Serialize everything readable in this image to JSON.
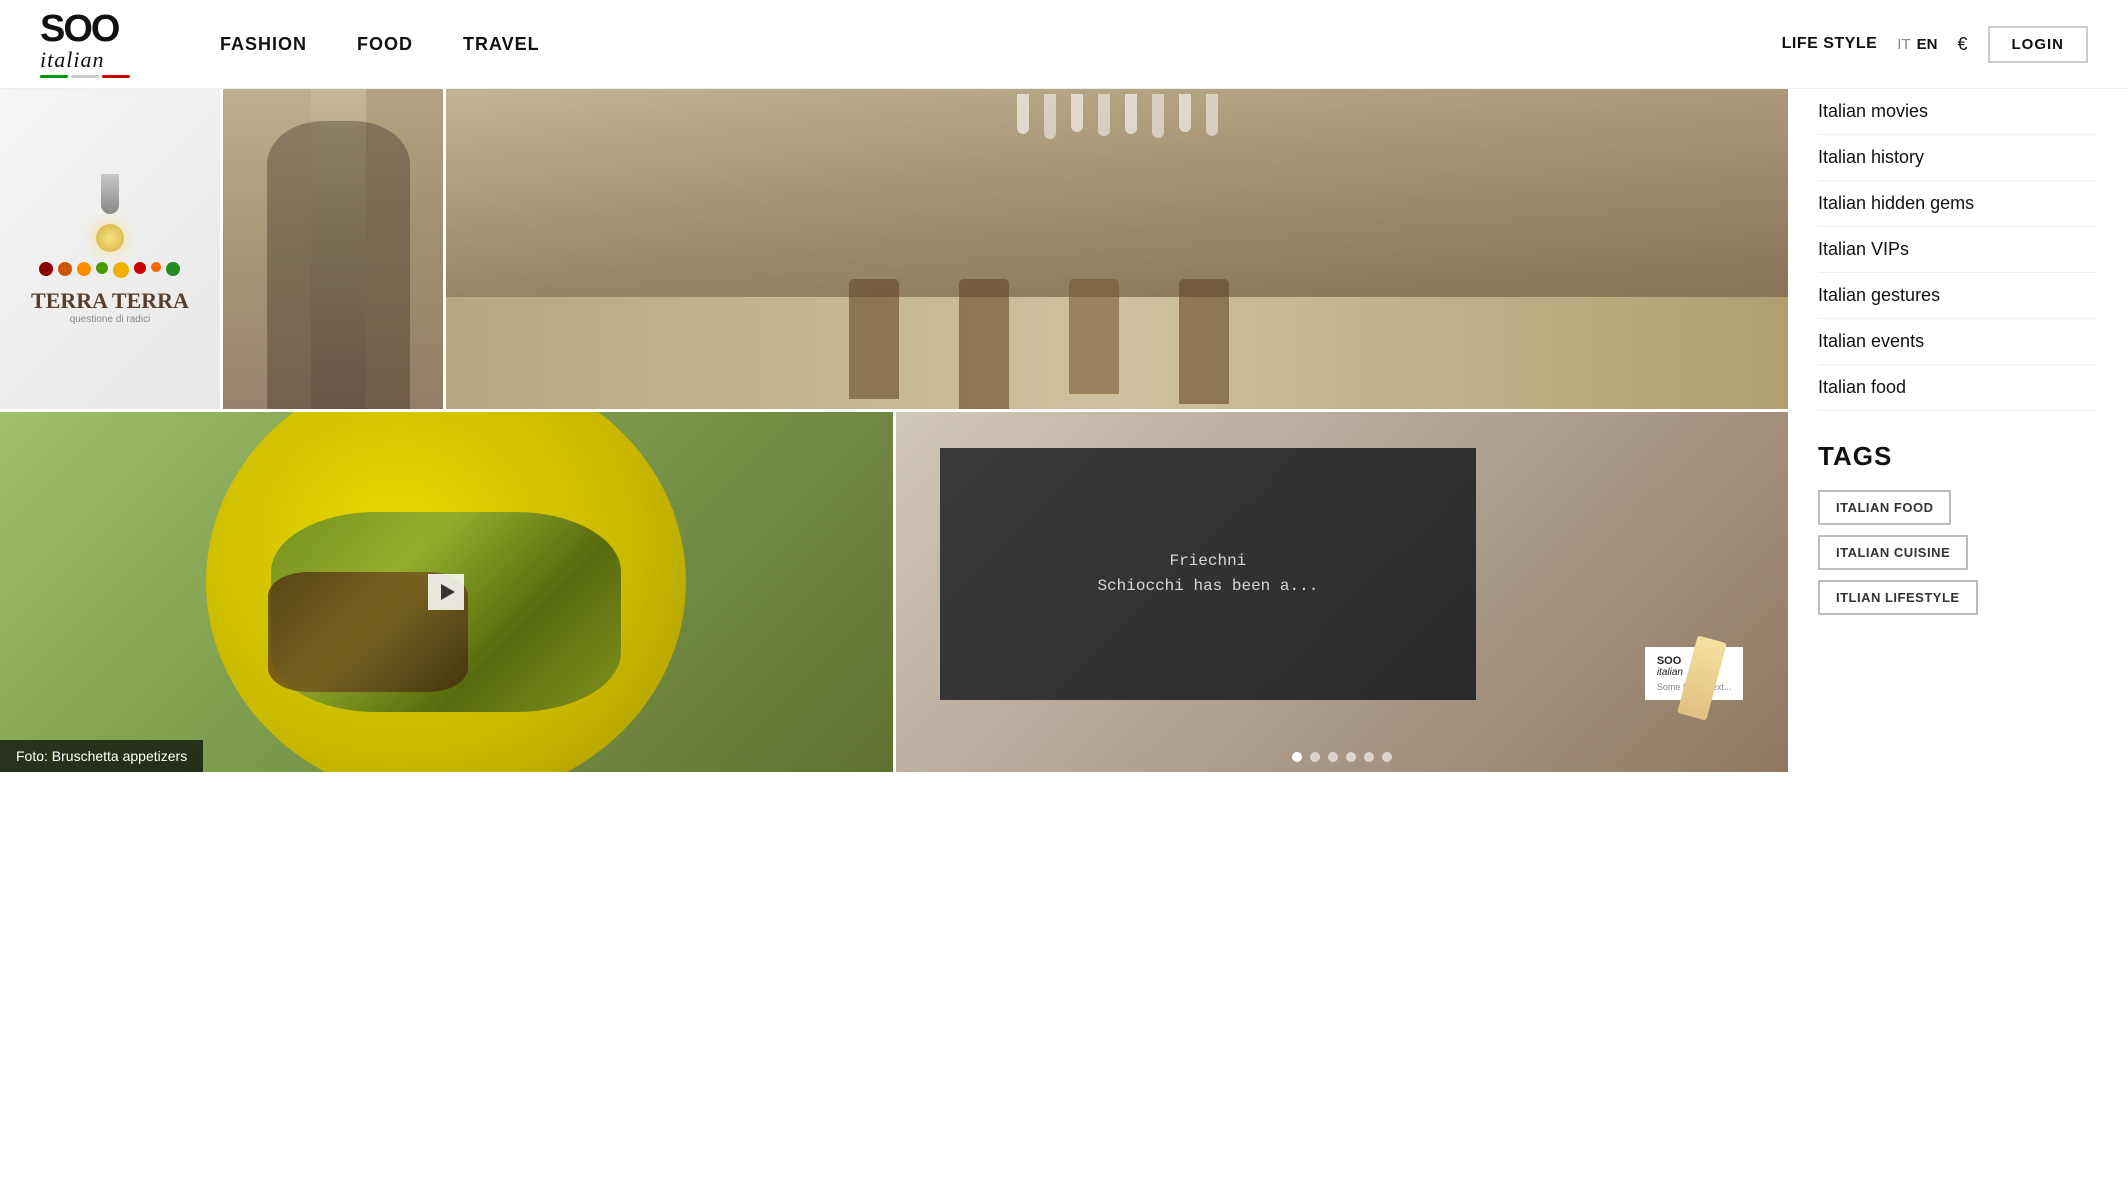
{
  "header": {
    "logo_soo": "SOO",
    "logo_italic": "italian",
    "logo_underline_colors": [
      "#008000",
      "#ffffff",
      "#ff0000"
    ],
    "nav_items": [
      {
        "label": "FASHION",
        "href": "#"
      },
      {
        "label": "FOOD",
        "href": "#"
      },
      {
        "label": "TRAVEL",
        "href": "#"
      }
    ],
    "lifestyle_label": "LIFE STYLE",
    "lang_it": "IT",
    "lang_en": "EN",
    "currency": "€",
    "login_label": "LOGIN"
  },
  "sidebar": {
    "links": [
      {
        "label": "Italian movies"
      },
      {
        "label": "Italian history"
      },
      {
        "label": "Italian hidden gems"
      },
      {
        "label": "Italian VIPs"
      },
      {
        "label": "Italian gestures"
      },
      {
        "label": "Italian events"
      },
      {
        "label": "Italian food"
      }
    ],
    "tags_heading": "TAGS",
    "tags": [
      {
        "label": "ITALIAN FOOD"
      },
      {
        "label": "ITALIAN CUISINE"
      },
      {
        "label": "ITLIAN LIFESTYLE"
      }
    ]
  },
  "images": {
    "terra_title": "TERRA TERRA",
    "terra_sub": "questione di radici",
    "couple_alt": "Italian couple walking in a street",
    "bar_alt": "Italian bar interior",
    "food_caption": "Foto: Bruschetta appetizers",
    "chalkboard_text": "Schiocchi has been a...",
    "soo_watermark": "SOO\nitalian"
  }
}
